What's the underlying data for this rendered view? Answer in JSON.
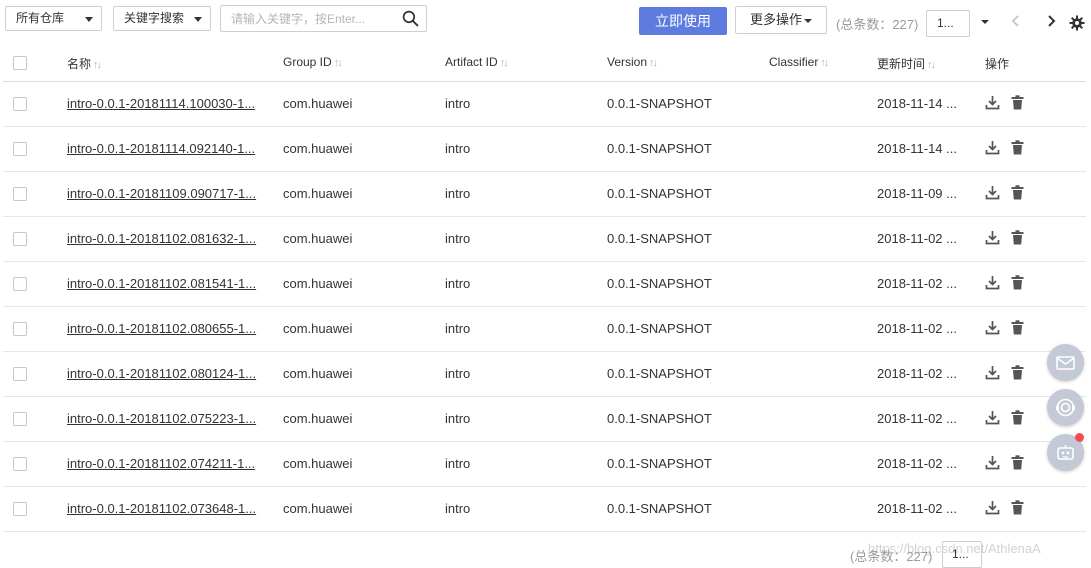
{
  "toolbar": {
    "repo_select": "所有仓库",
    "search_type_select": "关键字搜索",
    "search_placeholder": "请输入关键字，按Enter...",
    "primary_button": "立即使用",
    "more_actions": "更多操作",
    "total_text": "(总条数：227)",
    "page_size": "1..."
  },
  "table": {
    "headers": {
      "name": "名称",
      "group_id": "Group ID",
      "artifact_id": "Artifact ID",
      "version": "Version",
      "classifier": "Classifier",
      "updated": "更新时间",
      "actions": "操作"
    },
    "rows": [
      {
        "name": "intro-0.0.1-20181114.100030-1...",
        "group_id": "com.huawei",
        "artifact_id": "intro",
        "version": "0.0.1-SNAPSHOT",
        "classifier": "",
        "updated": "2018-11-14 ..."
      },
      {
        "name": "intro-0.0.1-20181114.092140-1...",
        "group_id": "com.huawei",
        "artifact_id": "intro",
        "version": "0.0.1-SNAPSHOT",
        "classifier": "",
        "updated": "2018-11-14 ..."
      },
      {
        "name": "intro-0.0.1-20181109.090717-1...",
        "group_id": "com.huawei",
        "artifact_id": "intro",
        "version": "0.0.1-SNAPSHOT",
        "classifier": "",
        "updated": "2018-11-09 ..."
      },
      {
        "name": "intro-0.0.1-20181102.081632-1...",
        "group_id": "com.huawei",
        "artifact_id": "intro",
        "version": "0.0.1-SNAPSHOT",
        "classifier": "",
        "updated": "2018-11-02 ..."
      },
      {
        "name": "intro-0.0.1-20181102.081541-1...",
        "group_id": "com.huawei",
        "artifact_id": "intro",
        "version": "0.0.1-SNAPSHOT",
        "classifier": "",
        "updated": "2018-11-02 ..."
      },
      {
        "name": "intro-0.0.1-20181102.080655-1...",
        "group_id": "com.huawei",
        "artifact_id": "intro",
        "version": "0.0.1-SNAPSHOT",
        "classifier": "",
        "updated": "2018-11-02 ..."
      },
      {
        "name": "intro-0.0.1-20181102.080124-1...",
        "group_id": "com.huawei",
        "artifact_id": "intro",
        "version": "0.0.1-SNAPSHOT",
        "classifier": "",
        "updated": "2018-11-02 ..."
      },
      {
        "name": "intro-0.0.1-20181102.075223-1...",
        "group_id": "com.huawei",
        "artifact_id": "intro",
        "version": "0.0.1-SNAPSHOT",
        "classifier": "",
        "updated": "2018-11-02 ..."
      },
      {
        "name": "intro-0.0.1-20181102.074211-1...",
        "group_id": "com.huawei",
        "artifact_id": "intro",
        "version": "0.0.1-SNAPSHOT",
        "classifier": "",
        "updated": "2018-11-02 ..."
      },
      {
        "name": "intro-0.0.1-20181102.073648-1...",
        "group_id": "com.huawei",
        "artifact_id": "intro",
        "version": "0.0.1-SNAPSHOT",
        "classifier": "",
        "updated": "2018-11-02 ..."
      }
    ]
  },
  "footer": {
    "total_text": "(总条数：227)",
    "page_size": "1...",
    "watermark": "https://blog.csdn.net/AthlenaA"
  },
  "icons": {
    "search": "search-icon",
    "download": "download-icon",
    "delete": "trash-icon",
    "prev": "chevron-left-icon",
    "next": "chevron-right-icon",
    "settings": "gear-icon",
    "mail": "mail-icon",
    "support": "headset-icon",
    "robot": "robot-icon"
  },
  "colors": {
    "primary": "#5e7ce0",
    "floating_button": "#c3cad5",
    "notification_dot": "#f05050"
  }
}
